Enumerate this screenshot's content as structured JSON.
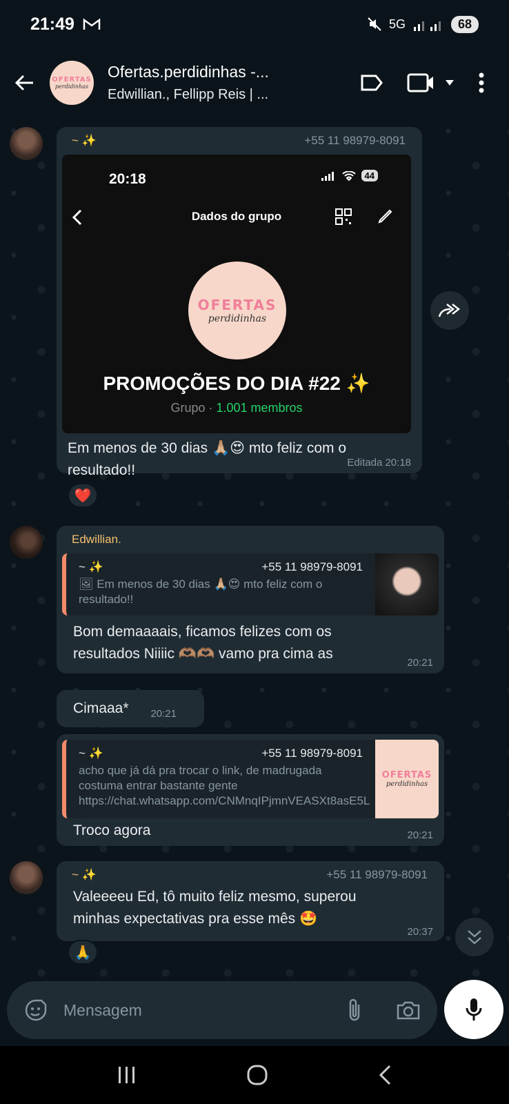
{
  "status_bar": {
    "time": "21:49",
    "mail_icon": "gmail-icon",
    "network": "5G",
    "battery": "68"
  },
  "header": {
    "title": "Ofertas.perdidinhas -...",
    "subtitle": "Edwillian., Fellipp Reis | ...",
    "avatar_top": "OFERTAS",
    "avatar_bottom": "perdidinhas"
  },
  "messages": {
    "m1": {
      "sender": "~ ✨",
      "phone": "+55 11 98979-8091",
      "embed": {
        "time": "20:18",
        "battery": "44",
        "screen_title": "Dados do grupo",
        "logo_top": "OFERTAS",
        "logo_bottom": "perdidinhas",
        "group_name": "PROMOÇÕES DO DIA #22 ✨",
        "group_label": "Grupo · ",
        "members": "1.001 membros"
      },
      "text_line1": "Em menos de 30 dias 🙏🏼😍 mto feliz com o",
      "text_line2": "resultado!!",
      "meta": "Editada  20:18",
      "reaction": "❤️"
    },
    "m2": {
      "sender": "Edwillian.",
      "quote_sender": "~ ✨",
      "quote_phone": "+55 11 98979-8091",
      "quote_text": "🖼 Em menos de 30 dias 🙏🏼😍 mto feliz com o resultado!!",
      "text_line1": "Bom demaaaais, ficamos felizes com os",
      "text_line2": "resultados Niiiic 🫶🏽🫶🏽 vamo pra cima as",
      "time": "20:21"
    },
    "m3": {
      "text": "Cimaaa*",
      "time": "20:21"
    },
    "m4": {
      "quote_sender": "~ ✨",
      "quote_phone": "+55 11 98979-8091",
      "quote_text": "acho que já dá pra trocar o link, de madrugada costuma entrar bastante gente https://chat.whatsapp.com/CNMnqIPjmnVEASXt8asE5L?...",
      "thumb_top": "OFERTAS",
      "thumb_bottom": "perdidinhas",
      "text": "Troco agora",
      "time": "20:21"
    },
    "m5": {
      "sender": "~ ✨",
      "phone": "+55 11 98979-8091",
      "text_line1": "Valeeeeu Ed, tô muito feliz mesmo, superou",
      "text_line2": "minhas expectativas pra esse mês 🤩",
      "time": "20:37",
      "reaction": "🙏"
    }
  },
  "composer": {
    "placeholder": "Mensagem"
  },
  "colors": {
    "background": "#0b141a",
    "bubble": "#202c33",
    "accent_green": "#25d366",
    "sender_name": "#f5c06f",
    "quote_bar": "#f38a6c",
    "logo_bg": "#f7d7c9"
  }
}
